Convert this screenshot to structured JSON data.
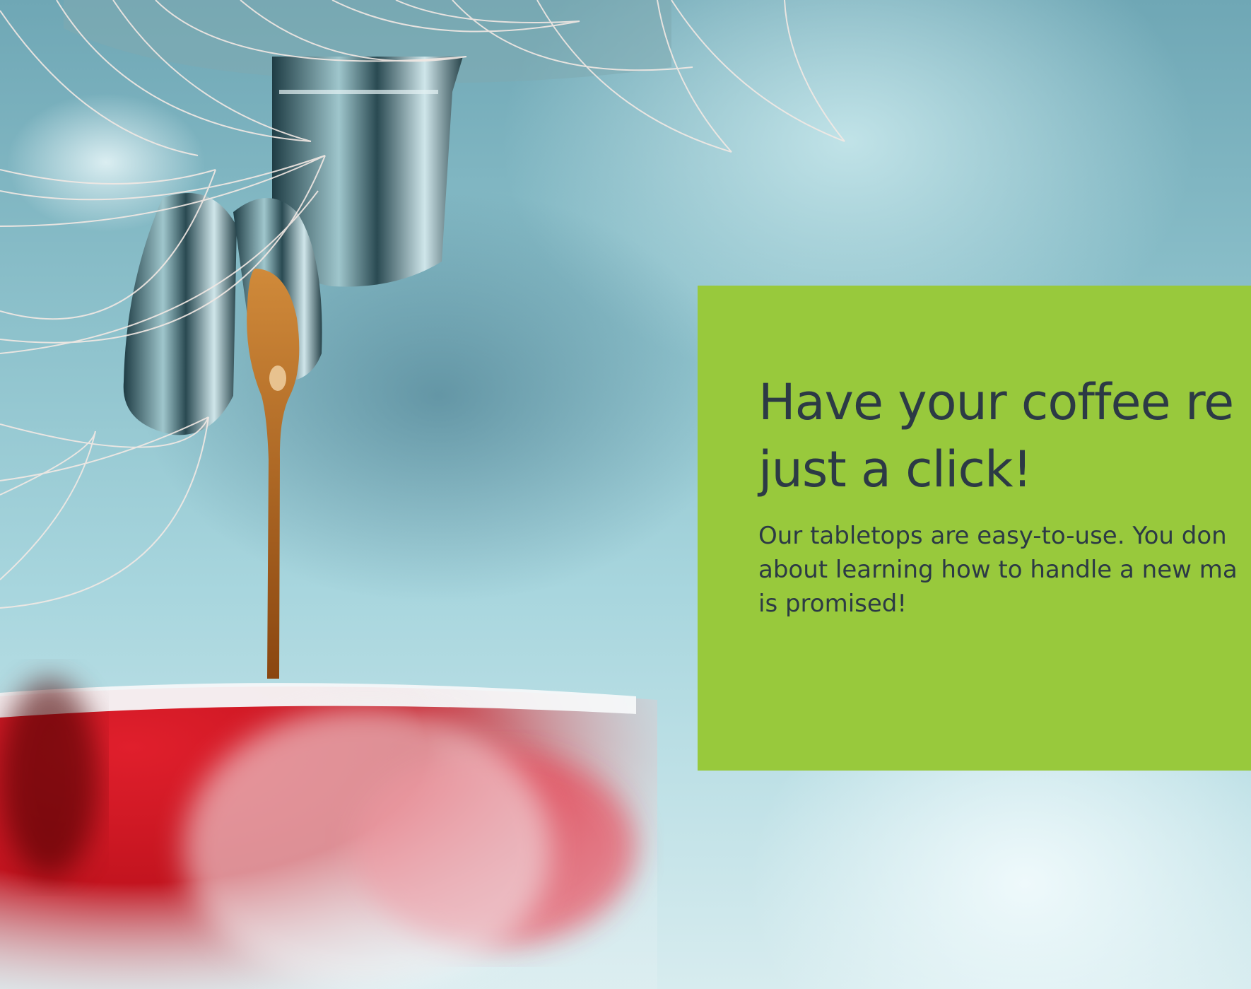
{
  "hero": {
    "title_lines": [
      "Have your coffee re",
      "just a click!"
    ],
    "text_lines": [
      "Our tabletops are easy-to-use. You don",
      "about learning how to handle a new ma",
      "is promised!"
    ]
  },
  "colors": {
    "card": "#98c93c",
    "text": "#2c3a45",
    "cup": "#d61a2a",
    "coffee": "#b0621c"
  },
  "icons": [
    "decorative-line-pattern"
  ]
}
